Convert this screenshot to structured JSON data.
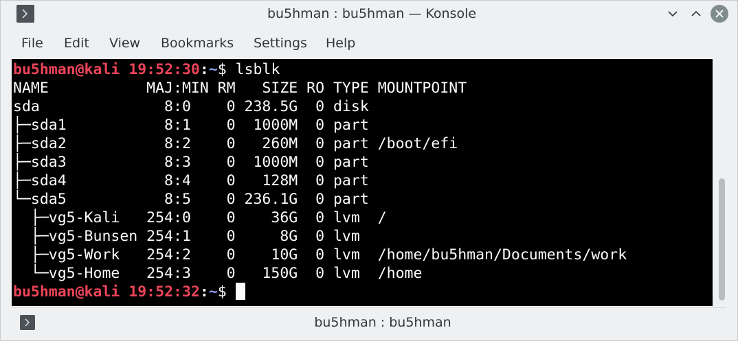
{
  "window": {
    "title": "bu5hman : bu5hman — Konsole",
    "app_icon": "konsole-icon",
    "controls": [
      "minimize-icon",
      "maximize-icon",
      "close-icon"
    ]
  },
  "menu": {
    "file": "File",
    "edit": "Edit",
    "view": "View",
    "bookmarks": "Bookmarks",
    "settings": "Settings",
    "help": "Help"
  },
  "terminal": {
    "prompt1": {
      "user": "bu5hman@kali",
      "time": "19:52:30",
      "sep": ":",
      "dir": "~",
      "dollar": "$",
      "command": " lsblk"
    },
    "output": [
      "NAME           MAJ:MIN RM   SIZE RO TYPE MOUNTPOINT",
      "sda              8:0    0 238.5G  0 disk",
      "├─sda1           8:1    0  1000M  0 part",
      "├─sda2           8:2    0   260M  0 part /boot/efi",
      "├─sda3           8:3    0  1000M  0 part",
      "├─sda4           8:4    0   128M  0 part",
      "└─sda5           8:5    0 236.1G  0 part",
      "  ├─vg5-Kali   254:0    0    36G  0 lvm  /",
      "  ├─vg5-Bunsen 254:1    0     8G  0 lvm",
      "  ├─vg5-Work   254:2    0    10G  0 lvm  /home/bu5hman/Documents/work",
      "  └─vg5-Home   254:3    0   150G  0 lvm  /home"
    ],
    "prompt2": {
      "user": "bu5hman@kali",
      "time": "19:52:32",
      "sep": ":",
      "dir": "~",
      "dollar": "$"
    },
    "colors": {
      "background": "#000000",
      "foreground": "#fcfcfc",
      "prompt_user": "#ed4459",
      "prompt_dir": "#8e9ff1"
    }
  },
  "tab": {
    "label": "bu5hman : bu5hman",
    "icon": "konsole-icon"
  }
}
